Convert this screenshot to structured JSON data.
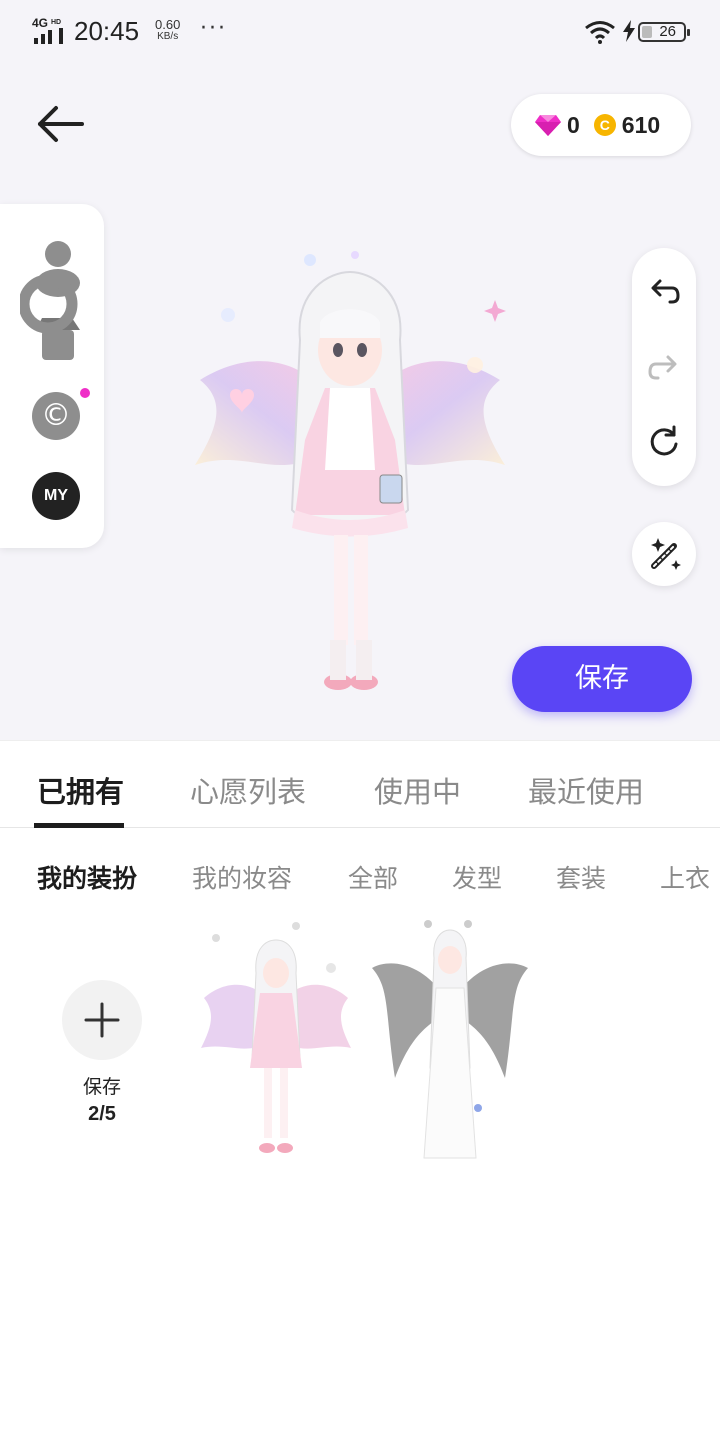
{
  "status_bar": {
    "network": "4G",
    "network_badge": "HD",
    "time": "20:45",
    "speed_value": "0.60",
    "speed_unit": "KB/s",
    "more": "···",
    "battery": "26"
  },
  "header": {
    "back_icon": "arrow-left-icon",
    "gems": "0",
    "coin_symbol": "C",
    "coins": "610"
  },
  "left_panel": {
    "body_icon": "avatar-body-icon",
    "c_label": "©",
    "my_label": "MY"
  },
  "right_tools": {
    "undo_icon": "undo-icon",
    "redo_icon": "redo-icon",
    "reset_icon": "reset-icon",
    "magic_icon": "magic-wand-icon"
  },
  "save_button": "保存",
  "tabs": [
    {
      "label": "已拥有",
      "active": true
    },
    {
      "label": "心愿列表",
      "active": false
    },
    {
      "label": "使用中",
      "active": false
    },
    {
      "label": "最近使用",
      "active": false
    }
  ],
  "subtabs": [
    {
      "label": "我的装扮",
      "active": true
    },
    {
      "label": "我的妆容",
      "active": false
    },
    {
      "label": "全部",
      "active": false
    },
    {
      "label": "发型",
      "active": false
    },
    {
      "label": "套装",
      "active": false
    },
    {
      "label": "上衣",
      "active": false
    }
  ],
  "saved_slots": {
    "label": "保存",
    "count": "2/5"
  },
  "colors": {
    "accent": "#5a45f5",
    "gem": "#ef2ec7",
    "coin": "#f7b500"
  }
}
